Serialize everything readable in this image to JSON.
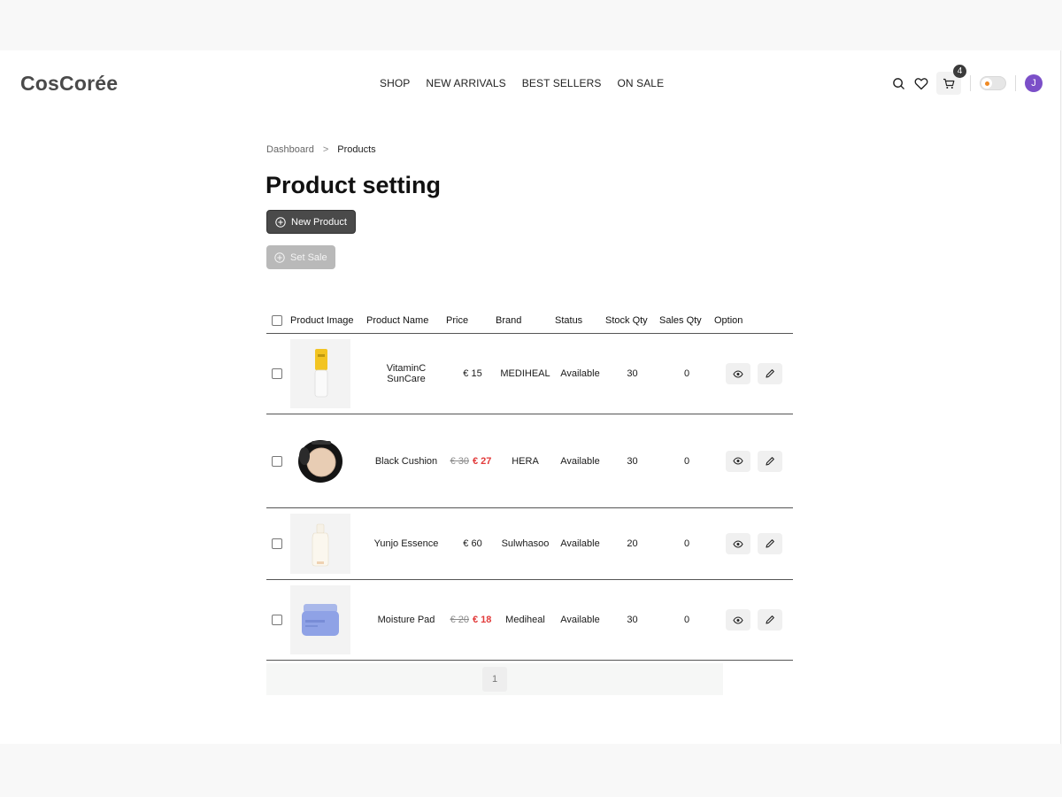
{
  "header": {
    "logo": "CosCorée",
    "nav": [
      "SHOP",
      "NEW ARRIVALS",
      "BEST SELLERS",
      "ON SALE"
    ],
    "cart_count": "4",
    "avatar_initial": "J",
    "toggle_accent": "#f08a24",
    "avatar_color": "#7b4fc8"
  },
  "breadcrumb": {
    "root": "Dashboard",
    "separator": ">",
    "current": "Products"
  },
  "page_title": "Product setting",
  "buttons": {
    "new_product": "New Product",
    "set_sale": "Set Sale"
  },
  "table": {
    "headers": [
      "Product Image",
      "Product Name",
      "Price",
      "Brand",
      "Status",
      "Stock Qty",
      "Sales Qty",
      "Option"
    ],
    "rows": [
      {
        "image": "yellow-tube",
        "name": "VitaminC SunCare",
        "price": "€ 15",
        "old_price": "",
        "brand": "MEDIHEAL",
        "status": "Available",
        "stock": "30",
        "sales": "0"
      },
      {
        "image": "black-cushion",
        "name": "Black Cushion",
        "price": "€ 27",
        "old_price": "€ 30",
        "brand": "HERA",
        "status": "Available",
        "stock": "30",
        "sales": "0"
      },
      {
        "image": "white-bottle",
        "name": "Yunjo Essence",
        "price": "€ 60",
        "old_price": "",
        "brand": "Sulwhasoo",
        "status": "Available",
        "stock": "20",
        "sales": "0"
      },
      {
        "image": "blue-jar",
        "name": "Moisture Pad",
        "price": "€ 18",
        "old_price": "€ 20",
        "brand": "Mediheal",
        "status": "Available",
        "stock": "30",
        "sales": "0"
      }
    ]
  },
  "pagination": {
    "current_page": "1"
  },
  "colors": {
    "sale_price": "#e23a3a",
    "primary_button": "#4a4a4a",
    "disabled_button": "#b9b9b9"
  }
}
